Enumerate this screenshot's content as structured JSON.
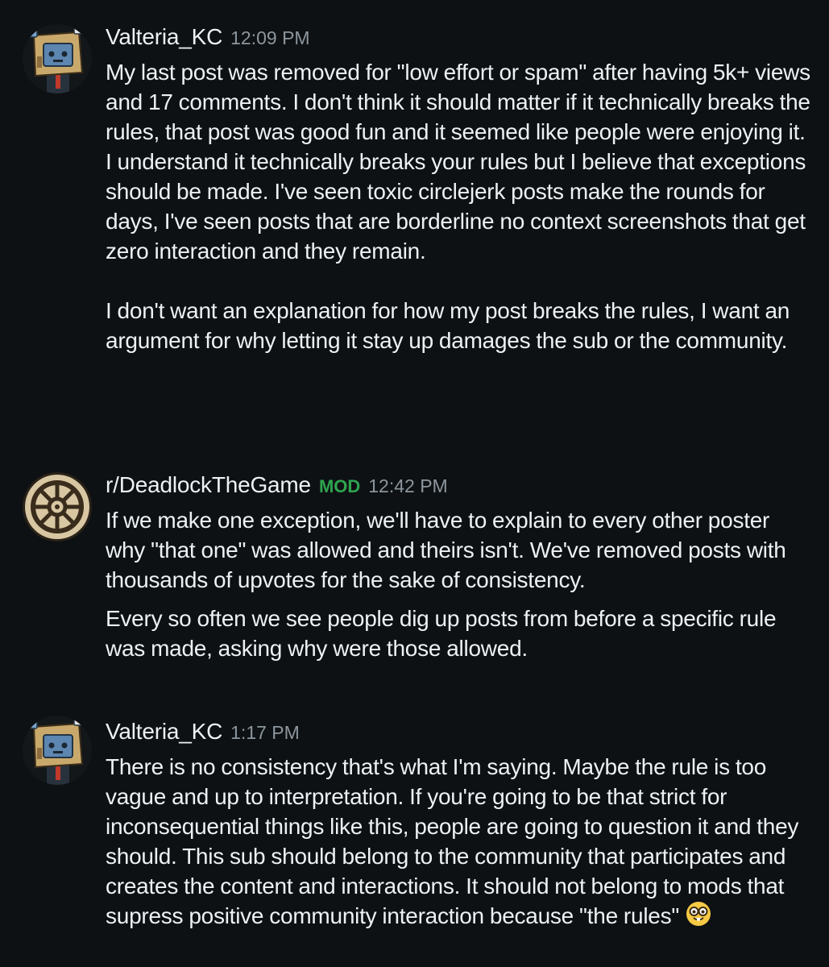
{
  "messages": [
    {
      "author": "Valteria_KC",
      "time": "12:09 PM",
      "paragraphs": [
        "My last post was removed for \"low effort or spam\" after having 5k+ views and 17 comments. I don't think it should matter if it technically breaks the rules, that post was good fun and it seemed like people were enjoying it. I understand it technically breaks your rules but I believe that exceptions should be made. I've seen toxic circlejerk posts make the rounds for days, I've seen posts that are borderline no context screenshots that get zero interaction and they remain.",
        "I don't want an explanation for how my post breaks the rules, I want an argument for why letting it stay up damages the sub or the community."
      ]
    },
    {
      "author": "r/DeadlockTheGame",
      "badge": "MOD",
      "time": "12:42 PM",
      "paragraphs": [
        "If we make one exception, we'll have to explain to every other poster why \"that one\" was allowed and theirs isn't. We've removed posts with thousands of upvotes for the sake of consistency.",
        "Every so often we see people dig up posts from before a specific rule was made, asking why were those allowed."
      ]
    },
    {
      "author": "Valteria_KC",
      "time": "1:17 PM",
      "paragraphs": [
        "There is no consistency that's what I'm saying. Maybe the rule is too vague and up to interpretation. If you're going to be that strict for inconsequential things like this, people are going to question it and they should. This sub should belong to the community that participates and creates the content and interactions. It should not belong to mods that supress positive community interaction because \"the rules\""
      ],
      "trailing_emoji": "nerd-face-emoji"
    }
  ]
}
